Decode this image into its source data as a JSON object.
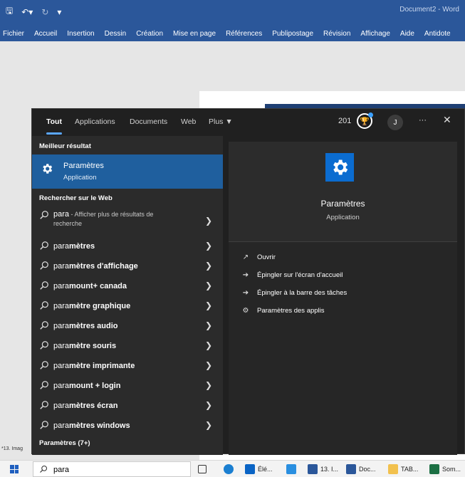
{
  "word": {
    "doc_title": "Document2 - Word",
    "ribbon_tabs": [
      "Fichier",
      "Accueil",
      "Insertion",
      "Dessin",
      "Création",
      "Mise en page",
      "Références",
      "Publipostage",
      "Révision",
      "Affichage",
      "Aide",
      "Antidote"
    ],
    "status_left": "*13. Imag"
  },
  "search": {
    "tabs": [
      "Tout",
      "Applications",
      "Documents",
      "Web",
      "Plus"
    ],
    "points": "201",
    "avatar_letter": "J",
    "more": "···",
    "close": "✕",
    "best_label": "Meilleur résultat",
    "best": {
      "title": "Paramètres",
      "subtitle": "Application"
    },
    "web_label": "Rechercher sur le Web",
    "web_first": {
      "title": "para",
      "rest": " - Afficher plus de résultats de",
      "line2": "recherche"
    },
    "suggestions": [
      {
        "pre": "para",
        "bold": "mètres"
      },
      {
        "pre": "para",
        "bold": "mètres d'affichage"
      },
      {
        "pre": "para",
        "bold": "mount+ canada"
      },
      {
        "pre": "para",
        "bold": "mètre graphique"
      },
      {
        "pre": "para",
        "bold": "mètres audio"
      },
      {
        "pre": "para",
        "bold": "mètre souris"
      },
      {
        "pre": "para",
        "bold": "mètre imprimante"
      },
      {
        "pre": "para",
        "bold": "mount + login"
      },
      {
        "pre": "para",
        "bold": "mètres écran"
      },
      {
        "pre": "para",
        "bold": "mètres windows"
      }
    ],
    "settings_section": "Paramètres (7+)",
    "detail": {
      "title": "Paramètres",
      "subtitle": "Application",
      "actions": [
        "Ouvrir",
        "Épingler sur l'écran d'accueil",
        "Épingler à la barre des tâches",
        "Paramètres des applis"
      ]
    }
  },
  "taskbar": {
    "search_value": "para",
    "items": [
      "Élé...",
      "13. I...",
      "Doc...",
      "TAB...",
      "Som..."
    ]
  },
  "colors": {
    "word_blue": "#2b579a",
    "highlight": "#1f5f9e",
    "accent": "#0b6cd0"
  }
}
